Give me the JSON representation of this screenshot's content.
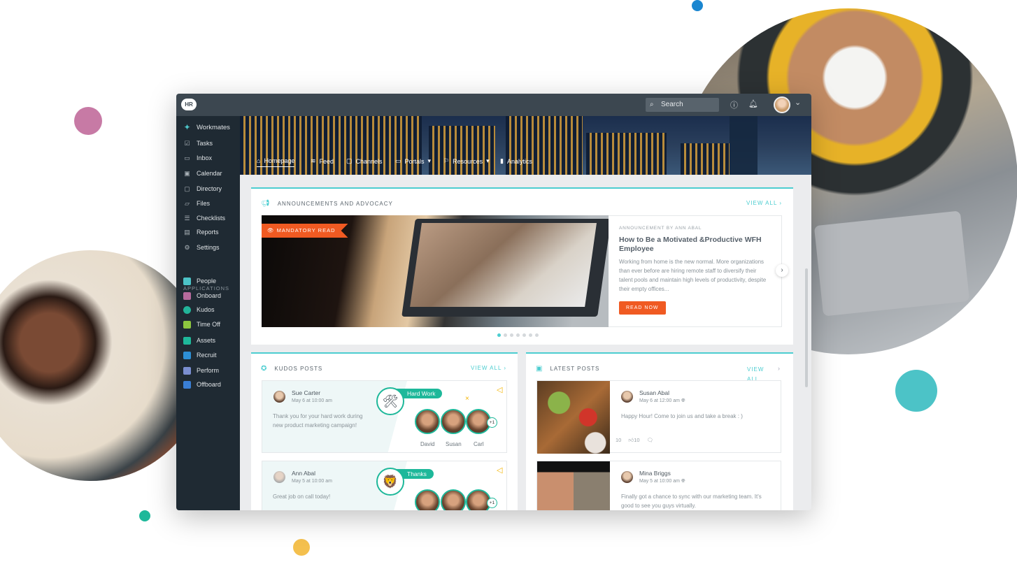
{
  "app": {
    "logo": "HR"
  },
  "topbar": {
    "search_placeholder": "Search",
    "help_icon": "question-circle",
    "bell_icon": "bell",
    "avatar_caret": "⌄"
  },
  "sidebar": {
    "items": [
      {
        "label": "Workmates",
        "icon": "workmates-logo"
      },
      {
        "label": "Tasks",
        "icon": "checkbox"
      },
      {
        "label": "Inbox",
        "icon": "inbox"
      },
      {
        "label": "Calendar",
        "icon": "calendar"
      },
      {
        "label": "Directory",
        "icon": "contact-card"
      },
      {
        "label": "Files",
        "icon": "folder"
      },
      {
        "label": "Checklists",
        "icon": "checklist"
      },
      {
        "label": "Reports",
        "icon": "report"
      },
      {
        "label": "Settings",
        "icon": "gear"
      }
    ],
    "applications_heading": "APPLICATIONS",
    "apps": [
      {
        "label": "People",
        "color": "#4cc3c7"
      },
      {
        "label": "Onboard",
        "color": "#b56a9c"
      },
      {
        "label": "Kudos",
        "color": "#22b59a"
      },
      {
        "label": "Time Off",
        "color": "#8dc63f"
      },
      {
        "label": "Assets",
        "color": "#1eb89a"
      },
      {
        "label": "Recruit",
        "color": "#2d8fd5"
      },
      {
        "label": "Perform",
        "color": "#7a8ed0"
      },
      {
        "label": "Offboard",
        "color": "#3a7fd5"
      }
    ]
  },
  "nav": {
    "tabs": [
      {
        "label": "Homepage",
        "icon": "home",
        "active": true
      },
      {
        "label": "Feed",
        "icon": "rss"
      },
      {
        "label": "Channels",
        "icon": "tv"
      },
      {
        "label": "Portals",
        "icon": "window",
        "caret": "▾"
      },
      {
        "label": "Resources",
        "icon": "bookmark",
        "caret": "▾"
      },
      {
        "label": "Analytics",
        "icon": "bar-chart"
      }
    ]
  },
  "announcements": {
    "title": "ANNOUNCEMENTS AND ADVOCACY",
    "view_all": "VIEW ALL",
    "badge": "MANDATORY READ",
    "byline": "ANNOUNCEMENT BY ANN ABAL",
    "headline": "How to Be a Motivated &Productive WFH Employee",
    "body": "Working from home is the new normal. More organizations than ever before are hiring remote staff to diversify their talent pools and maintain high levels of productivity, despite their empty offices...",
    "button": "READ NOW",
    "current_slide": 1,
    "total_slides": 7
  },
  "kudos": {
    "title": "KUDOS POSTS",
    "view_all": "VIEW ALL",
    "posts": [
      {
        "author": "Sue Carter",
        "date": "May 6 at 10:00 am",
        "text": "Thank you for your hard work during new product marketing campaign!",
        "badge": "Hard Work",
        "badge_icon": "🛠",
        "recipients": [
          "David",
          "Susan",
          "Carl"
        ],
        "more": "+1"
      },
      {
        "author": "Ann Abal",
        "date": "May 5 at 10:00 am",
        "text": "Great job on call today!",
        "badge": "Thanks",
        "badge_icon": "🦁",
        "more": "+1"
      }
    ]
  },
  "latest": {
    "title": "LATEST POSTS",
    "view_all": "VIEW ALL",
    "posts": [
      {
        "author": "Susan Abal",
        "date": "May 6 at 12:00 am",
        "text": "Happy Hour! Come to join us and take a break : )",
        "views": "10",
        "likes": "10"
      },
      {
        "author": "Mina Briggs",
        "date": "May 5 at 10:00 am",
        "text": "Finally got a chance to sync with our marketing team. It's good to see you guys virtually."
      }
    ]
  },
  "colors": {
    "accent": "#4ccdd0",
    "cta": "#f05a22",
    "kudos_green": "#1eb89a",
    "sidebar": "#1f2a33",
    "titlebar": "#3c4750"
  }
}
